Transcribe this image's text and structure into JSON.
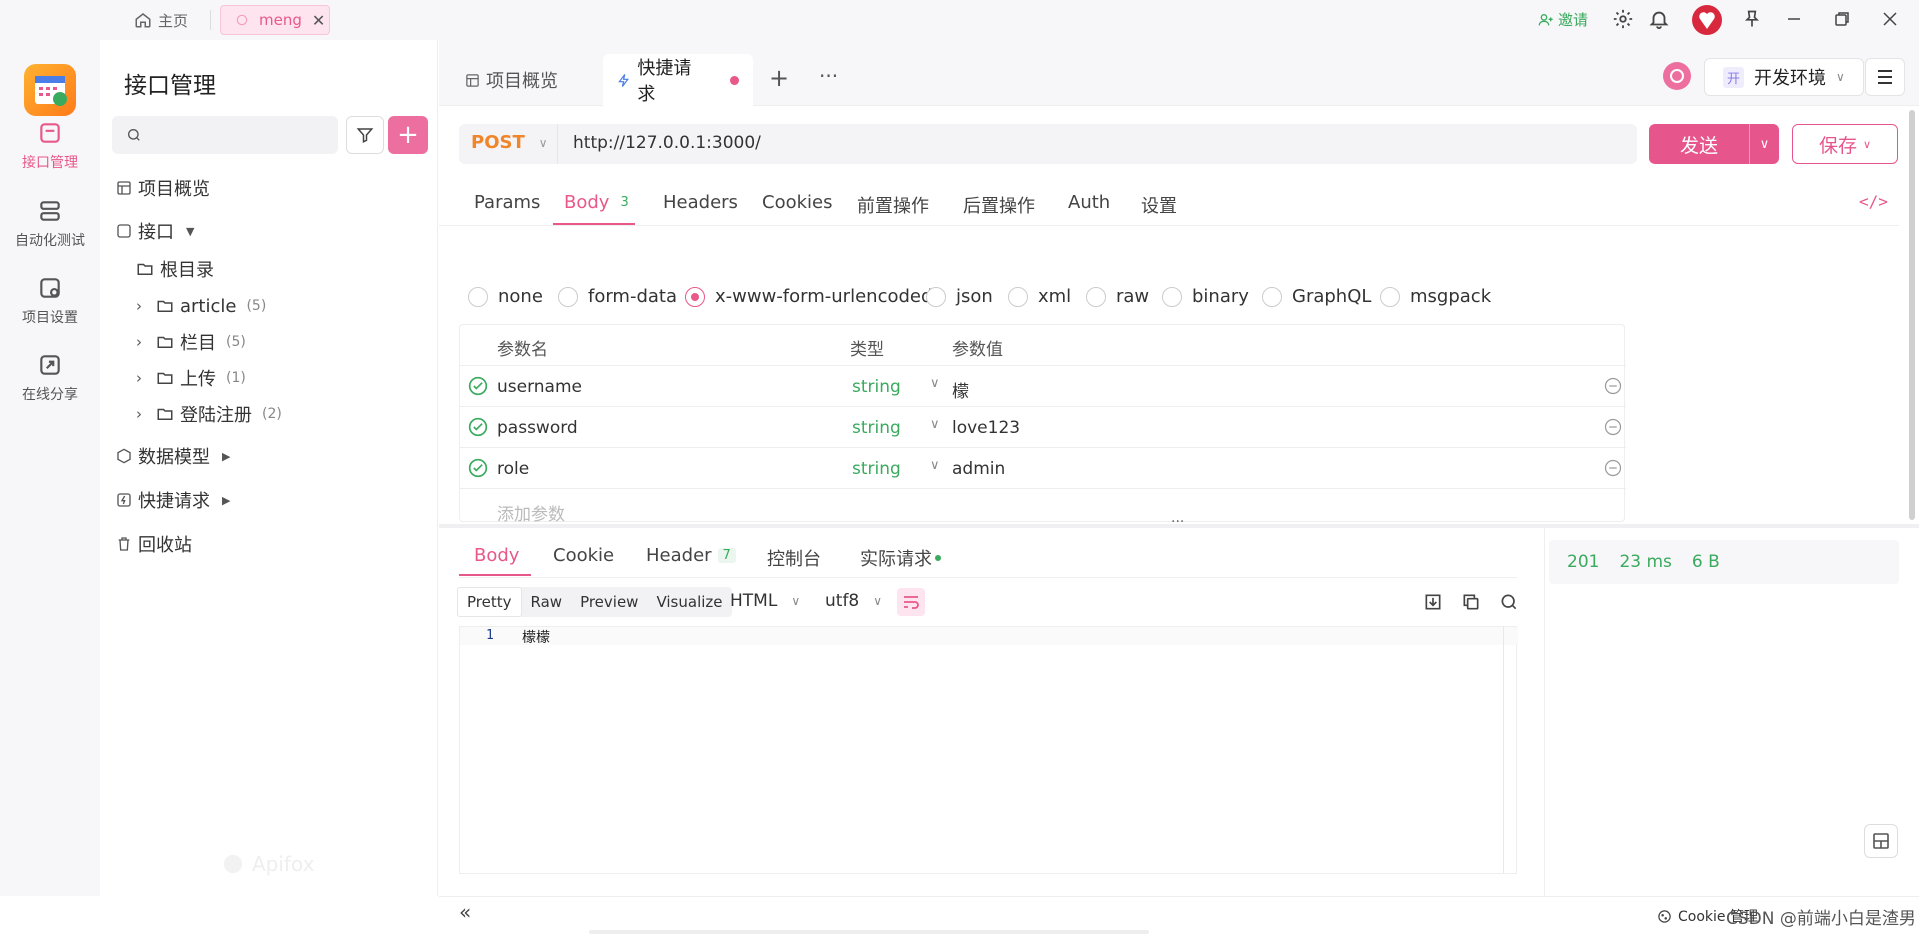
{
  "titlebar": {
    "home_label": "主页",
    "tab_label": "meng",
    "invite_label": "邀请"
  },
  "rail": {
    "items": [
      {
        "label": "接口管理",
        "icon": "api-icon"
      },
      {
        "label": "自动化测试",
        "icon": "automation-icon"
      },
      {
        "label": "项目设置",
        "icon": "project-settings-icon"
      },
      {
        "label": "在线分享",
        "icon": "share-icon"
      }
    ]
  },
  "sidebar": {
    "title": "接口管理",
    "search_placeholder": "",
    "tree": {
      "overview": "项目概览",
      "interfaces": "接口",
      "root": "根目录",
      "folders": [
        {
          "name": "article",
          "count": "(5)"
        },
        {
          "name": "栏目",
          "count": "(5)"
        },
        {
          "name": "上传",
          "count": "(1)"
        },
        {
          "name": "登陆注册",
          "count": "(2)"
        }
      ],
      "data_model": "数据模型",
      "quick_request": "快捷请求",
      "recycle": "回收站"
    },
    "watermark": "Apifox"
  },
  "main": {
    "tabs": [
      {
        "label": "项目概览"
      },
      {
        "label": "快捷请求"
      }
    ],
    "env_badge": "开",
    "env_label": "开发环境",
    "request": {
      "method": "POST",
      "url": "http://127.0.0.1:3000/",
      "send_label": "发送",
      "save_label": "保存"
    },
    "param_tabs": [
      "Params",
      "Body",
      "Headers",
      "Cookies",
      "前置操作",
      "后置操作",
      "Auth",
      "设置"
    ],
    "body_count": "3",
    "body_types": [
      "none",
      "form-data",
      "x-www-form-urlencoded",
      "json",
      "xml",
      "raw",
      "binary",
      "GraphQL",
      "msgpack"
    ],
    "table_headers": {
      "name": "参数名",
      "type": "类型",
      "value": "参数值"
    },
    "params": [
      {
        "name": "username",
        "type": "string",
        "value": "檬"
      },
      {
        "name": "password",
        "type": "string",
        "value": "love123"
      },
      {
        "name": "role",
        "type": "string",
        "value": "admin"
      }
    ],
    "add_param": "添加参数",
    "response": {
      "tabs": [
        "Body",
        "Cookie",
        "Header",
        "控制台",
        "实际请求"
      ],
      "header_count": "7",
      "view_modes": [
        "Pretty",
        "Raw",
        "Preview",
        "Visualize"
      ],
      "format": "HTML",
      "encoding": "utf8",
      "line_number": "1",
      "content": "檬檬",
      "status": "201",
      "time": "23 ms",
      "size": "6 B"
    },
    "footer": {
      "cookie_label": "Cookie 管理",
      "watermark": "CSDN @前端小白是渣男"
    }
  },
  "colors": {
    "accent": "#e8588a",
    "success": "#3aaa5e",
    "method": "#f0852a"
  }
}
